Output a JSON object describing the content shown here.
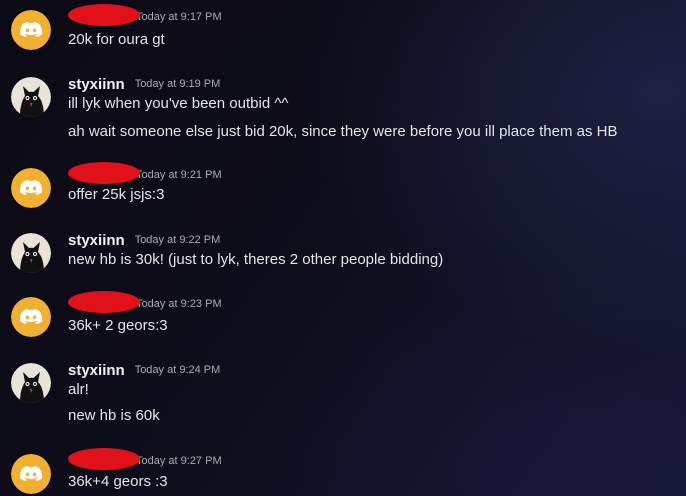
{
  "messages": [
    {
      "author": "",
      "author_redacted": true,
      "avatar": "discord-logo-icon",
      "timestamp": "Today at 9:17 PM",
      "lines": [
        "20k for oura gt"
      ]
    },
    {
      "author": "styxiinn",
      "author_redacted": false,
      "avatar": "black-cat-avatar",
      "timestamp": "Today at 9:19 PM",
      "lines": [
        "ill lyk when you've been outbid ^^",
        "ah wait someone else just bid 20k, since they were before you ill place them as HB"
      ]
    },
    {
      "author": "",
      "author_redacted": true,
      "avatar": "discord-logo-icon",
      "timestamp": "Today at 9:21 PM",
      "lines": [
        "offer 25k jsjs:3"
      ]
    },
    {
      "author": "styxiinn",
      "author_redacted": false,
      "avatar": "black-cat-avatar",
      "timestamp": "Today at 9:22 PM",
      "lines": [
        "new hb is 30k! (just to lyk, theres 2 other people bidding)"
      ]
    },
    {
      "author": "",
      "author_redacted": true,
      "avatar": "discord-logo-icon",
      "timestamp": "Today at 9:23 PM",
      "lines": [
        "36k+ 2 geors:3"
      ]
    },
    {
      "author": "styxiinn",
      "author_redacted": false,
      "avatar": "black-cat-avatar",
      "timestamp": "Today at 9:24 PM",
      "lines": [
        "alr!",
        "new hb is 60k"
      ]
    },
    {
      "author": "",
      "author_redacted": true,
      "avatar": "discord-logo-icon",
      "timestamp": "Today at 9:27 PM",
      "lines": [
        "36k+4 geors :3"
      ]
    }
  ],
  "colors": {
    "discord_avatar_bg": "#f0b132",
    "redaction": "#e0111a"
  }
}
